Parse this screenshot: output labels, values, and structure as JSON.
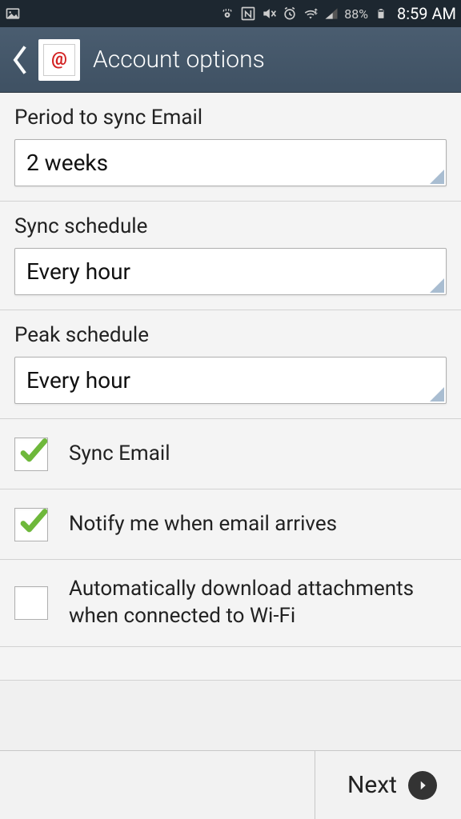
{
  "status": {
    "battery_pct": "88%",
    "time": "8:59 AM"
  },
  "header": {
    "title": "Account options"
  },
  "settings": {
    "period_label": "Period to sync Email",
    "period_value": "2 weeks",
    "sync_schedule_label": "Sync schedule",
    "sync_schedule_value": "Every hour",
    "peak_schedule_label": "Peak schedule",
    "peak_schedule_value": "Every hour"
  },
  "checks": {
    "sync_email_label": "Sync Email",
    "sync_email_checked": true,
    "notify_label": "Notify me when email arrives",
    "notify_checked": true,
    "auto_dl_label": "Automatically download attachments when connected to Wi-Fi",
    "auto_dl_checked": false
  },
  "footer": {
    "next_label": "Next"
  }
}
